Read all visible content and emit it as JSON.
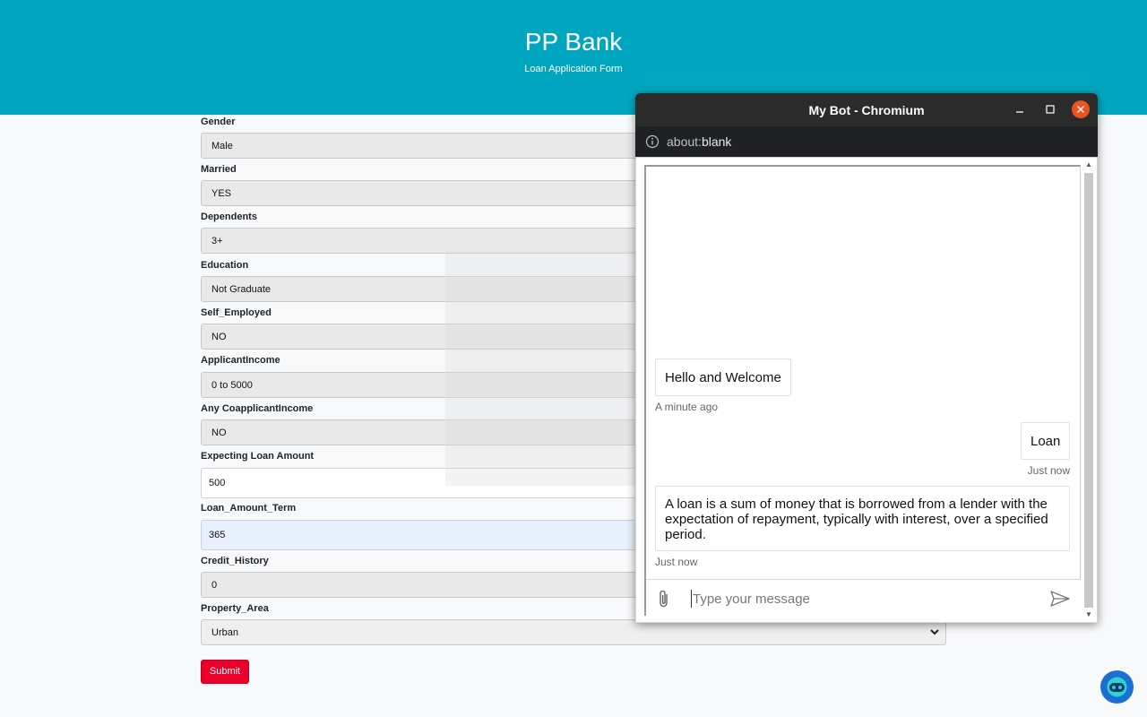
{
  "header": {
    "title": "PP Bank",
    "subtitle": "Loan Application Form"
  },
  "form": {
    "fields": [
      {
        "label": "Gender",
        "value": "Male"
      },
      {
        "label": "Married",
        "value": "YES"
      },
      {
        "label": "Dependents",
        "value": "3+"
      },
      {
        "label": "Education",
        "value": "Not Graduate"
      },
      {
        "label": "Self_Employed",
        "value": "NO"
      },
      {
        "label": "ApplicantIncome",
        "value": "0 to 5000"
      },
      {
        "label": "Any CoapplicantIncome",
        "value": "NO"
      },
      {
        "label": "Expecting Loan Amount",
        "value": "500"
      },
      {
        "label": "Loan_Amount_Term",
        "value": "365"
      },
      {
        "label": "Credit_History",
        "value": "0"
      },
      {
        "label": "Property_Area",
        "value": "Urban"
      }
    ],
    "submit_label": "Submit"
  },
  "bot_window": {
    "title": "My Bot - Chromium",
    "url_scheme": "about:",
    "url_path": "blank",
    "messages": [
      {
        "from": "bot",
        "text": "Hello and Welcome",
        "time": "A minute ago"
      },
      {
        "from": "user",
        "text": "Loan",
        "time": "Just now"
      },
      {
        "from": "bot",
        "text": "A loan is a sum of money that is borrowed from a lender with the expectation of repayment, typically with interest, over a specified period.",
        "time": "Just now"
      }
    ],
    "input_placeholder": "Type your message"
  },
  "colors": {
    "header": "#00a6bf",
    "submit": "#ea0029",
    "titlebar": "#2b2b2b",
    "close": "#e95420"
  }
}
